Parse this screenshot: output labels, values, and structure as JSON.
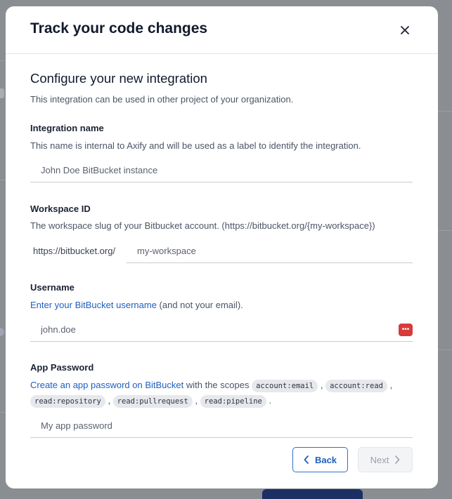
{
  "modal": {
    "title": "Track your code changes",
    "close_icon": "close-icon"
  },
  "section": {
    "title": "Configure your new integration",
    "subtitle": "This integration can be used in other project of your organization."
  },
  "integration_name": {
    "label": "Integration name",
    "help": "This name is internal to Axify and will be used as a label to identify the integration.",
    "placeholder": "John Doe BitBucket instance"
  },
  "workspace": {
    "label": "Workspace ID",
    "help": "The workspace slug of your Bitbucket account. (https://bitbucket.org/{my-workspace})",
    "prefix": "https://bitbucket.org/",
    "placeholder": "my-workspace"
  },
  "username": {
    "label": "Username",
    "help_link": "Enter your BitBucket username",
    "help_rest": " (and not your email).",
    "placeholder": "john.doe",
    "password_manager_icon": "password-manager-icon"
  },
  "app_password": {
    "label": "App Password",
    "help_link": "Create an app password on BitBucket",
    "help_text": " with the scopes ",
    "scopes": [
      "account:email",
      "account:read",
      "read:repository",
      "read:pullrequest",
      "read:pipeline"
    ],
    "placeholder": "My app password"
  },
  "buttons": {
    "back": "Back",
    "next": "Next"
  }
}
